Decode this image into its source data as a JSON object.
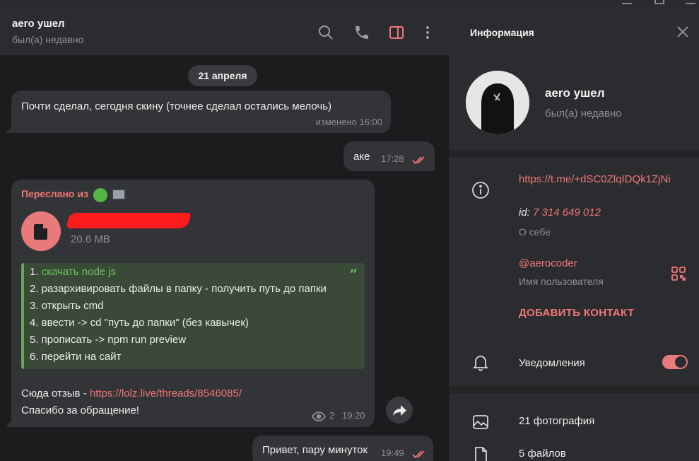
{
  "header": {
    "title": "aero ушел",
    "status": "был(а) недавно",
    "icons": [
      "search-icon",
      "phone-icon",
      "sidebar-toggle-icon",
      "more-vertical-icon"
    ]
  },
  "chat": {
    "date": "21 апреля",
    "messages": [
      {
        "text": "Почти сделал, сегодня скину (точнее сделал остались мелочь)",
        "meta": "изменено 16:00"
      },
      {
        "text": "аке",
        "time": "17:28"
      },
      {
        "forwarded_label": "Переслано из",
        "file_size": "20.6 MB",
        "quote_lines": [
          {
            "num": "1. ",
            "text": "скачать node js"
          },
          {
            "num": "",
            "text": "2. разархивировать файлы в папку - получить путь до папки"
          },
          {
            "num": "",
            "text": "3. открыть cmd"
          },
          {
            "num": "",
            "text": "4. ввести -> cd \"путь до папки\" (без кавычек)"
          },
          {
            "num": "",
            "text": "5. прописать -> npm run preview"
          },
          {
            "num": "",
            "text": "6. перейти на сайт"
          }
        ],
        "quote_mark": "”",
        "review_prefix": "Сюда отзыв - ",
        "review_link": "https://lolz.live/threads/8546085/",
        "thanks": "Спасибо за обращение!",
        "views": "2",
        "time": "19:20"
      },
      {
        "text": "Привет, пару минуток",
        "time": "19:49"
      }
    ]
  },
  "info_panel": {
    "title": "Информация",
    "name": "aero ушел",
    "status": "был(а) недавно",
    "link": "https://t.me/+dSC0ZlqIDQk1ZjNi",
    "id_label": "id:",
    "id_value": " 7 314 649 012",
    "about_label": "О себе",
    "username": "@aerocoder",
    "username_label": "Имя пользователя",
    "add_contact": "ДОБАВИТЬ КОНТАКТ",
    "notifications_label": "Уведомления",
    "notifications_on": true,
    "photos": "21 фотография",
    "files": "5 файлов"
  },
  "colors": {
    "accent": "#f07777",
    "quote_green": "#6cc45e",
    "bubble": "#333437",
    "panel": "#2b2c2f"
  }
}
